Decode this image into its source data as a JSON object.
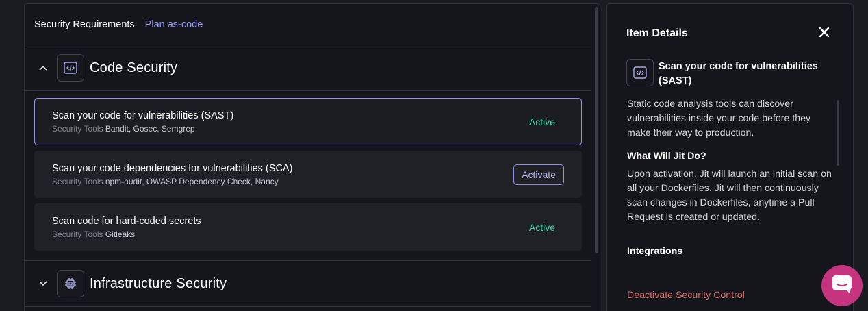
{
  "header": {
    "title": "Security Requirements",
    "plan_link": "Plan as-code"
  },
  "categories": [
    {
      "title": "Code Security",
      "expanded": true,
      "icon": "code-icon",
      "items": [
        {
          "name": "Scan your code for vulnerabilities (SAST)",
          "tools_label": "Security Tools",
          "tools": "Bandit, Gosec, Semgrep",
          "status": "Active",
          "selected": true
        },
        {
          "name": "Scan your code dependencies for vulnerabilities (SCA)",
          "tools_label": "Security Tools",
          "tools": "npm-audit, OWASP Dependency Check, Nancy",
          "action": "Activate"
        },
        {
          "name": "Scan code for hard-coded secrets",
          "tools_label": "Security Tools",
          "tools": "Gitleaks",
          "status": "Active"
        }
      ]
    },
    {
      "title": "Infrastructure Security",
      "expanded": false,
      "icon": "chip-icon"
    }
  ],
  "details": {
    "header": "Item Details",
    "item_title": "Scan your code for vulnerabilities (SAST)",
    "description": "Static code analysis tools can discover vulnerabilities inside your code before they make their way to production.",
    "what_title": "What Will Jit Do?",
    "what_text": "Upon activation, Jit will launch an initial scan on all your Dockerfiles. Jit will then continuously scan changes in Dockerfiles, anytime a Pull Request is created or updated.",
    "integrations_title": "Integrations",
    "deactivate_label": "Deactivate Security Control"
  },
  "colors": {
    "accent": "#8f92e8",
    "active": "#3fd9a3",
    "danger": "#e06a66",
    "chat": "#c6337e"
  }
}
